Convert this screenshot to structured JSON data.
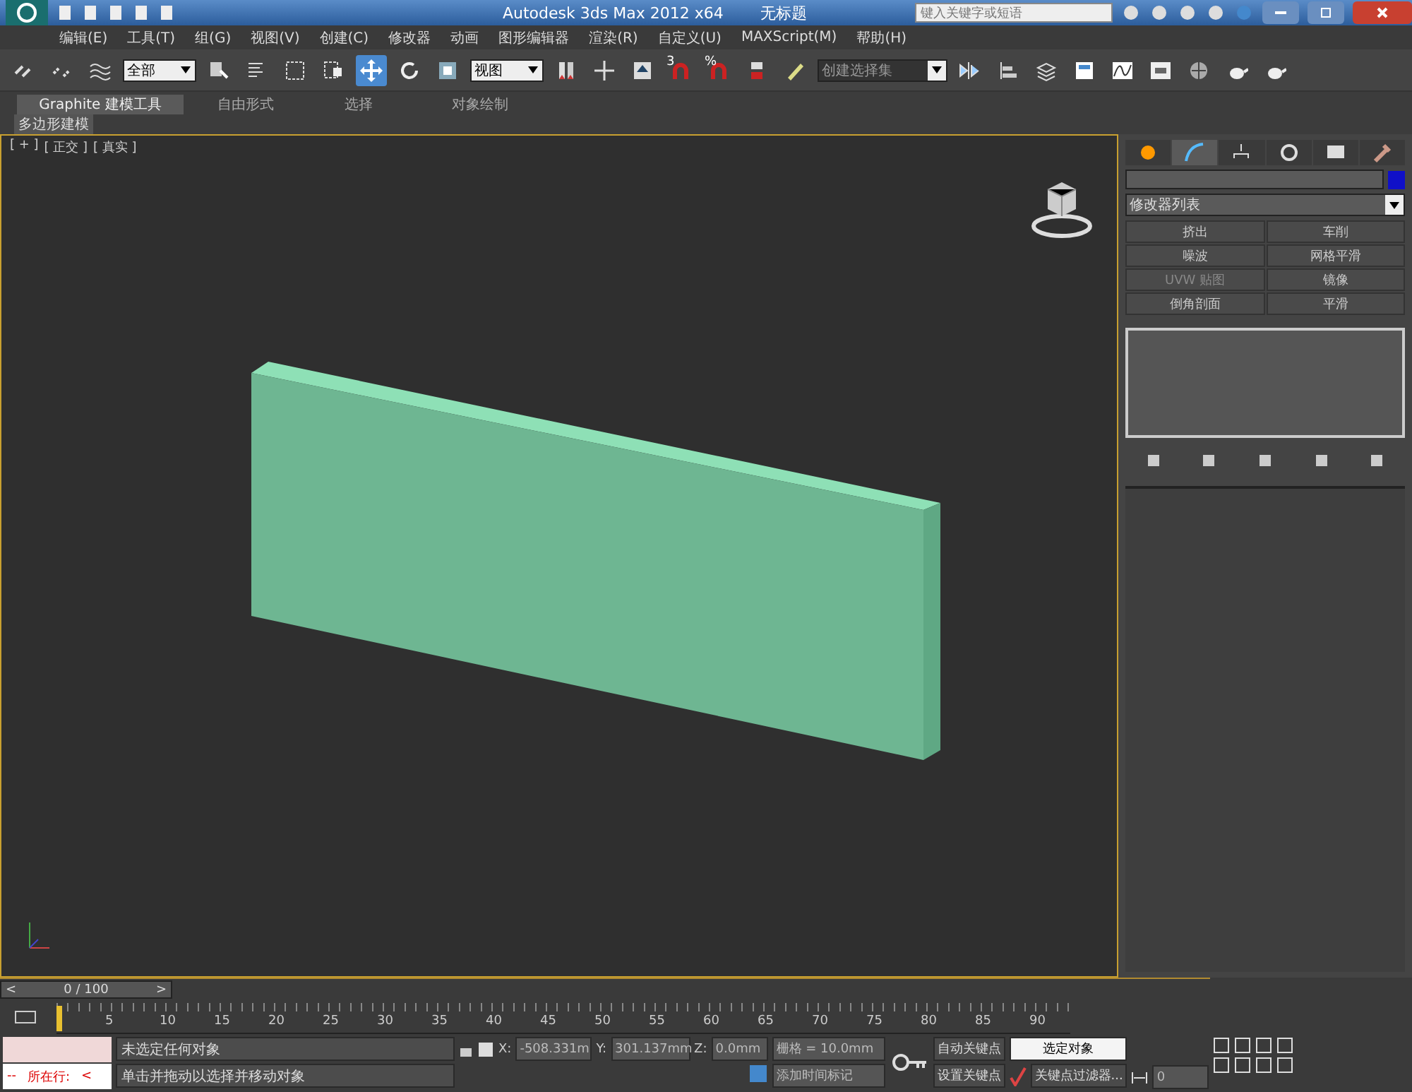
{
  "window": {
    "title": "Autodesk 3ds Max  2012 x64",
    "document": "无标题",
    "search": {
      "placeholder": "键入关键字或短语"
    }
  },
  "menu": [
    "编辑(E)",
    "工具(T)",
    "组(G)",
    "视图(V)",
    "创建(C)",
    "修改器",
    "动画",
    "图形编辑器",
    "渲染(R)",
    "自定义(U)",
    "MAXScript(M)",
    "帮助(H)"
  ],
  "toolbar": {
    "filter": "全部",
    "coord": "视图",
    "snap_labels": [
      "3",
      "%"
    ],
    "selection_set": "创建选择集",
    "transform_tools": [
      {
        "selected": true
      },
      {
        "selected": false
      },
      {
        "selected": false
      }
    ]
  },
  "ribbon": {
    "tabs": [
      {
        "label": "Graphite 建模工具",
        "selected": true
      },
      {
        "label": "自由形式",
        "selected": false
      },
      {
        "label": "选择",
        "selected": false
      },
      {
        "label": "对象绘制",
        "selected": false
      }
    ],
    "panel": "多边形建模"
  },
  "viewport": {
    "labels": [
      "[ + ]",
      "[ 正交 ]",
      "[ 真实 ]"
    ]
  },
  "command_panel": {
    "tabs": [
      {
        "selected": false
      },
      {
        "selected": true
      },
      {
        "selected": false
      },
      {
        "selected": false
      },
      {
        "selected": false
      },
      {
        "selected": false
      }
    ],
    "modifier_list": "修改器列表",
    "buttons": [
      {
        "label": "挤出",
        "disabled": false
      },
      {
        "label": "车削",
        "disabled": false
      },
      {
        "label": "噪波",
        "disabled": false
      },
      {
        "label": "网格平滑",
        "disabled": false
      },
      {
        "label": "UVW 贴图",
        "disabled": true
      },
      {
        "label": "镜像",
        "disabled": false
      },
      {
        "label": "倒角剖面",
        "disabled": false
      },
      {
        "label": "平滑",
        "disabled": false
      }
    ]
  },
  "timeline": {
    "frame": "0 / 100",
    "prev": "<",
    "next": ">",
    "level": 0,
    "ticks": [
      "5",
      "10",
      "15",
      "20",
      "25",
      "30",
      "35",
      "40",
      "45",
      "50",
      "55",
      "60",
      "65",
      "70",
      "75",
      "80",
      "85",
      "90"
    ]
  },
  "status": {
    "script_prefix": "--",
    "script_label": "所在行:",
    "script_arrow": "<",
    "selection": "未选定任何对象",
    "prompt": "单击并拖动以选择并移动对象",
    "x_label": "X:",
    "x": "-508.331m",
    "y_label": "Y:",
    "y": "301.137mm",
    "z_label": "Z:",
    "z": "0.0mm",
    "grid": "栅格 = 10.0mm",
    "add_tag": "添加时间标记",
    "auto_key": "自动关键点",
    "set_key": "设置关键点",
    "key_mode": "选定对象",
    "key_filters": "关键点过滤器...",
    "current_frame": "0"
  }
}
